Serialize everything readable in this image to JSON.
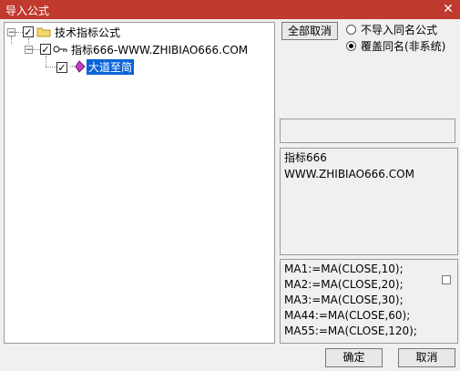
{
  "window": {
    "title": "导入公式",
    "close_glyph": "✕"
  },
  "tree": {
    "root": {
      "label": "技术指标公式",
      "checked": true,
      "expander": "−"
    },
    "child": {
      "label": "指标666-WWW.ZHIBIAO666.COM",
      "checked": true,
      "expander": "−"
    },
    "leaf": {
      "label": "大道至简",
      "checked": true,
      "selected": true
    }
  },
  "options": {
    "deselect_all_label": "全部取消",
    "radio_no_import": "不导入同名公式",
    "radio_overwrite": "覆盖同名(非系统)",
    "selected": "overwrite"
  },
  "info": {
    "line1": "指标666",
    "line2": "WWW.ZHIBIAO666.COM"
  },
  "formula": {
    "lines": [
      "MA1:=MA(CLOSE,10);",
      "MA2:=MA(CLOSE,20);",
      "MA3:=MA(CLOSE,30);",
      "MA44:=MA(CLOSE,60);",
      "MA55:=MA(CLOSE,120);"
    ]
  },
  "buttons": {
    "ok": "确定",
    "cancel": "取消"
  }
}
